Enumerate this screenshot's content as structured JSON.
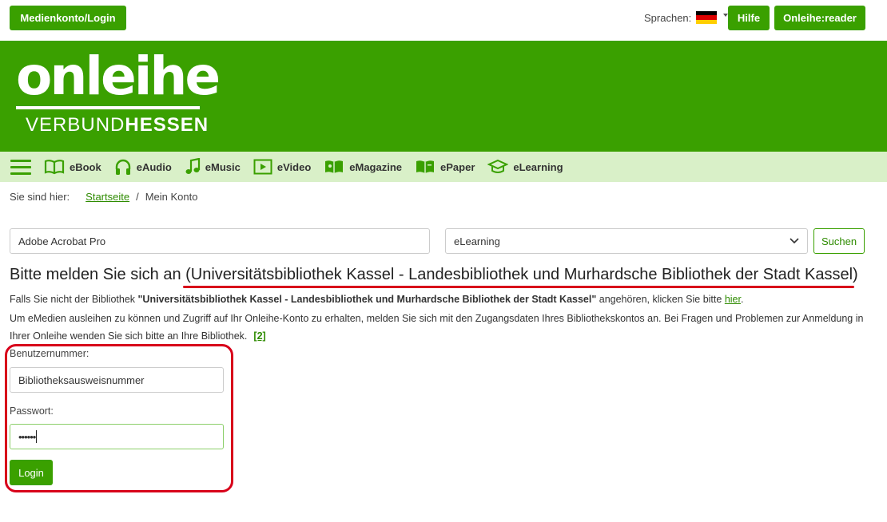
{
  "topbar": {
    "account_label": "Medienkonto/Login",
    "languages_label": "Sprachen:",
    "help_label": "Hilfe",
    "reader_label": "Onleihe:reader"
  },
  "brand": {
    "logo_text": "onleihe",
    "sub_light": "VERBUND",
    "sub_bold": "HESSEN",
    "color": "#3aa000"
  },
  "nav": {
    "items": [
      {
        "label": "eBook",
        "icon": "book-icon"
      },
      {
        "label": "eAudio",
        "icon": "headphones-icon"
      },
      {
        "label": "eMusic",
        "icon": "music-note-icon"
      },
      {
        "label": "eVideo",
        "icon": "play-icon"
      },
      {
        "label": "eMagazine",
        "icon": "magazine-icon"
      },
      {
        "label": "ePaper",
        "icon": "paper-icon"
      },
      {
        "label": "eLearning",
        "icon": "graduation-cap-icon"
      }
    ]
  },
  "breadcrumb": {
    "prefix": "Sie sind hier:",
    "home": "Startseite",
    "separator": "/",
    "current": "Mein Konto"
  },
  "search": {
    "query": "Adobe Acrobat Pro",
    "category": "eLearning",
    "submit_label": "Suchen"
  },
  "login": {
    "heading_prefix": "Bitte melden Sie sich an",
    "heading_library": "(Universitätsbibliothek Kassel - Landesbibliothek und Murhardsche Bibliothek der Stadt Kassel)",
    "note_prefix": "Falls Sie nicht der Bibliothek ",
    "note_library": "\"Universitätsbibliothek Kassel - Landesbibliothek und Murhardsche Bibliothek der Stadt Kassel\"",
    "note_suffix": " angehören, klicken Sie bitte ",
    "note_link": "hier",
    "note_end": ".",
    "info": "Um eMedien ausleihen zu können und Zugriff auf Ihr Onleihe-Konto zu erhalten, melden Sie sich mit den Zugangsdaten Ihres Bibliothekskontos an. Bei Fragen und Problemen zur Anmeldung in Ihrer Onleihe wenden Sie sich bitte an Ihre Bibliothek.",
    "info_ref": "[2]",
    "user_label": "Benutzernummer:",
    "user_value": "Bibliotheksausweisnummer",
    "pass_label": "Passwort:",
    "pass_value": "••••••",
    "submit_label": "Login"
  },
  "colors": {
    "accent": "#3aa000",
    "nav_bg": "#d9f0c8",
    "highlight": "#d8001a"
  }
}
